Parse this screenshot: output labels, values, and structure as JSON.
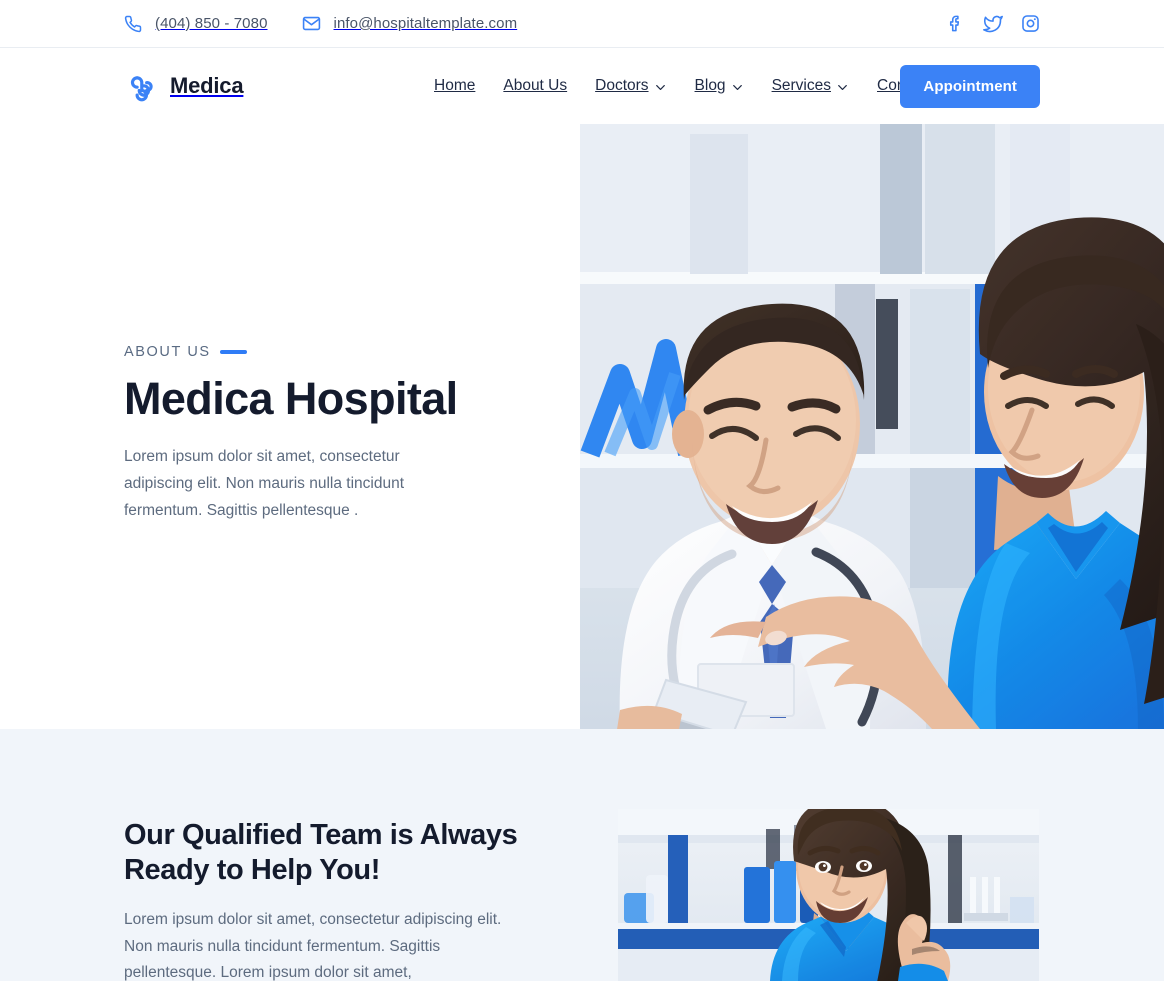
{
  "topbar": {
    "phone": {
      "icon": "phone-icon",
      "text": "(404) 850 - 7080"
    },
    "email": {
      "icon": "mail-icon",
      "text": "info@hospitaltemplate.com"
    },
    "social": [
      {
        "icon": "facebook-icon",
        "label": "Facebook"
      },
      {
        "icon": "twitter-icon",
        "label": "Twitter"
      },
      {
        "icon": "instagram-icon",
        "label": "Instagram"
      }
    ]
  },
  "nav": {
    "logo_icon": "medica-cross-logo-icon",
    "brand": "Medica",
    "links": [
      {
        "label": "Home",
        "has_dropdown": false
      },
      {
        "label": "About Us",
        "has_dropdown": false
      },
      {
        "label": "Doctors",
        "has_dropdown": true
      },
      {
        "label": "Blog",
        "has_dropdown": true
      },
      {
        "label": "Services",
        "has_dropdown": true
      },
      {
        "label": "Contact",
        "has_dropdown": false
      }
    ],
    "cta_label": "Appointment"
  },
  "hero": {
    "eyebrow": "ABOUT US",
    "title": "Medica Hospital",
    "body": "Lorem ipsum dolor sit amet, consectetur adipiscing elit. Non mauris nulla tincidunt fermentum. Sagittis pellentesque .",
    "image_alt": "Male doctor in white coat with stethoscope smiling beside female nurse in blue scrubs"
  },
  "team": {
    "title": "Our Qualified Team is Always Ready to Help You!",
    "body": "Lorem ipsum dolor sit amet, consectetur adipiscing elit. Non mauris nulla tincidunt fermentum. Sagittis pellentesque. Lorem ipsum dolor sit amet,",
    "image_alt": "Smiling female lab technician in blue scrubs giving a thumbs up"
  },
  "colors": {
    "accent_blue": "#3b82f6",
    "dark_navy": "#141b2d",
    "body_text": "#5d6b7f",
    "section_bg": "#f1f5fa",
    "white": "#ffffff"
  }
}
